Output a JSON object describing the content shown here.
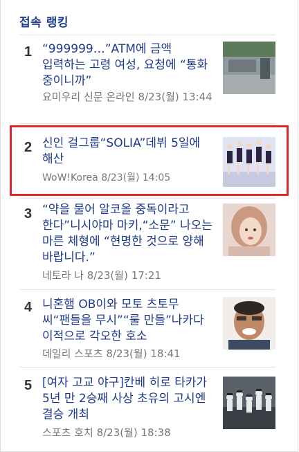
{
  "section": {
    "title": "접속 랭킹"
  },
  "items": [
    {
      "rank": "1",
      "headline": "“999999…”ATM에 금액 입력하는 고령 여성, 요청에 “통화 중이니까”",
      "source": "요미우리 신문 온라인",
      "time": "8/23(월) 13:44",
      "thumb": "street-scene-photo"
    },
    {
      "rank": "2",
      "headline": "신인 걸그룹“SOLIA”데뷔 5일에 해산",
      "source": "WoW!Korea",
      "time": "8/23(월) 14:05",
      "thumb": "girl-group-photo"
    },
    {
      "rank": "3",
      "headline": "“약을 물어 알코올 중독이라고 한다”니시야마 마키,“소문” 나오는 마른 체형에 “현명한 것으로 양해 바랍니다.”",
      "source": "네토라 나",
      "time": "8/23(월) 17:21",
      "thumb": "woman-portrait-photo"
    },
    {
      "rank": "4",
      "headline": "니혼햄 OB이와 모토 츠토무 씨“팬들을 무시”“룰 만들”나카다 이적으로 각오한 호소",
      "source": "데일리 스포츠",
      "time": "8/23(월) 18:41",
      "thumb": "man-portrait-photo"
    },
    {
      "rank": "5",
      "headline": "[여자 고교 야구]칸베 히로 타카가 5년 만 2승째 사상 초유의 고시엔 결승 개최",
      "source": "스포츠 호치",
      "time": "8/23(월) 18:38",
      "thumb": "baseball-team-photo"
    }
  ],
  "colors": {
    "headline": "#1d3a8a",
    "section_title": "#1f3f8f",
    "meta": "#777777",
    "highlight_border": "#e0262b"
  }
}
